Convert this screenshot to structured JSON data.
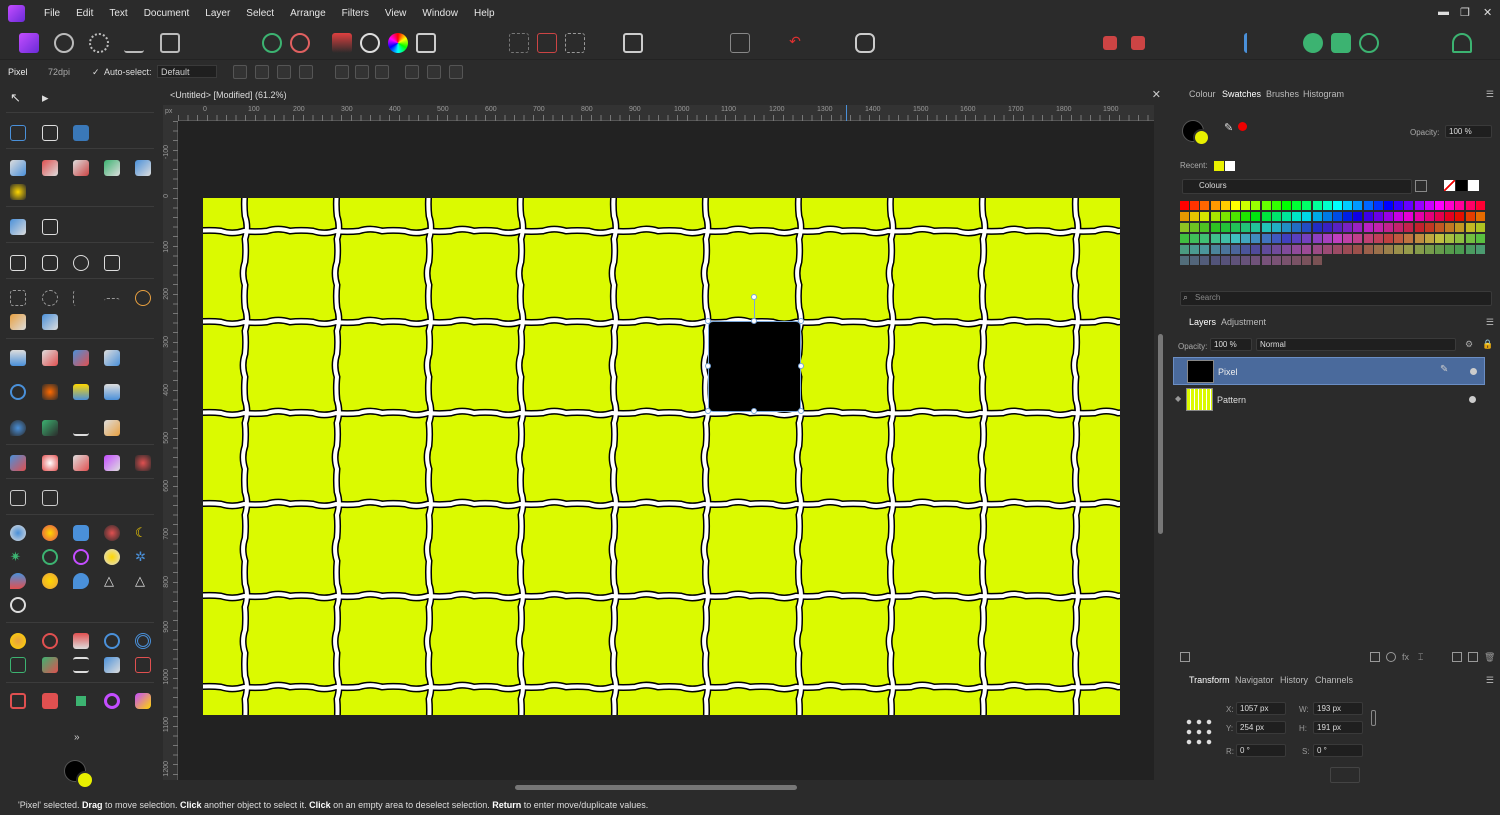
{
  "menubar": {
    "items": [
      "File",
      "Edit",
      "Text",
      "Document",
      "Layer",
      "Select",
      "Arrange",
      "Filters",
      "View",
      "Window",
      "Help"
    ],
    "window_controls": [
      "minimize-icon",
      "restore-icon",
      "close-icon"
    ]
  },
  "context_bar": {
    "mode": "Pixel",
    "dpi": "72dpi",
    "auto_select_label": "Auto-select:",
    "auto_select_value": "Default"
  },
  "document": {
    "tab_title": "<Untitled> [Modified] (61.2%)",
    "ruler_top": [
      "0",
      "100",
      "200",
      "300",
      "400",
      "500",
      "600",
      "700",
      "800",
      "900",
      "1000",
      "1100",
      "1200",
      "1300",
      "1400",
      "1500",
      "1600",
      "1700",
      "1800",
      "1900"
    ],
    "ruler_left": [
      "-100",
      "0",
      "100",
      "200",
      "300",
      "400",
      "500",
      "600",
      "700",
      "800",
      "900",
      "1000",
      "1100",
      "1200"
    ],
    "ruler_unit": "px",
    "artboard_color": "#dbfa00"
  },
  "status_bar": {
    "parts": [
      {
        "text": "'Pixel' selected. ",
        "bold": false
      },
      {
        "text": "Drag",
        "bold": true
      },
      {
        "text": " to move selection. ",
        "bold": false
      },
      {
        "text": "Click",
        "bold": true
      },
      {
        "text": " another object to select it. ",
        "bold": false
      },
      {
        "text": "Click",
        "bold": true
      },
      {
        "text": " on an empty area to deselect selection. ",
        "bold": false
      },
      {
        "text": "Return",
        "bold": true
      },
      {
        "text": " to enter move/duplicate values.",
        "bold": false
      }
    ]
  },
  "colour_panel": {
    "tabs": [
      "Colour",
      "Swatches",
      "Brushes",
      "Histogram"
    ],
    "active_tab": "Swatches",
    "opacity_label": "Opacity:",
    "opacity_value": "100 %",
    "recent_label": "Recent:",
    "palette_name": "Colours",
    "search_placeholder": "Search",
    "primary_color": "#000000",
    "secondary_color": "#e8f000"
  },
  "layers_panel": {
    "tabs": [
      "Layers",
      "Adjustment"
    ],
    "active_tab": "Layers",
    "opacity_label": "Opacity:",
    "opacity_value": "100 %",
    "blend_mode": "Normal",
    "layers": [
      {
        "name": "Pixel",
        "selected": true
      },
      {
        "name": "Pattern",
        "selected": false
      }
    ]
  },
  "transform_panel": {
    "tabs": [
      "Transform",
      "Navigator",
      "History",
      "Channels"
    ],
    "active_tab": "Transform",
    "x_label": "X:",
    "x": "1057 px",
    "y_label": "Y:",
    "y": "254 px",
    "w_label": "W:",
    "w": "193 px",
    "h_label": "H:",
    "h": "191 px",
    "r_label": "R:",
    "r": "0 °",
    "s_label": "S:",
    "s": "0 °"
  }
}
